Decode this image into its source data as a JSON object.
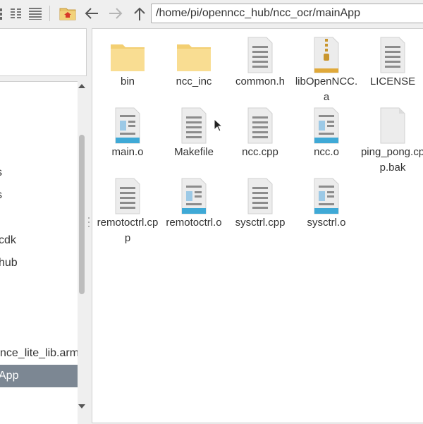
{
  "toolbar": {
    "path": "/home/pi/openncc_hub/ncc_ocr/mainApp",
    "icons": [
      "icon-view-icon",
      "compact-view-icon",
      "list-view-icon",
      "home-icon",
      "back-icon",
      "forward-icon",
      "up-icon"
    ]
  },
  "sidebar": {
    "tree": [
      {
        "label": "s",
        "selected": false
      },
      {
        "label": "s",
        "selected": false
      },
      {
        "label": "cdk",
        "selected": false
      },
      {
        "label": "hub",
        "selected": false
      },
      {
        "label": "nce_lite_lib.arml",
        "selected": false
      },
      {
        "label": "App",
        "selected": true
      }
    ]
  },
  "files": [
    {
      "name": "bin",
      "type": "folder"
    },
    {
      "name": "ncc_inc",
      "type": "folder"
    },
    {
      "name": "common.h",
      "type": "text"
    },
    {
      "name": "libOpenNCC.a",
      "type": "archive"
    },
    {
      "name": "LICENSE",
      "type": "text"
    },
    {
      "name": "main.o",
      "type": "object"
    },
    {
      "name": "Makefile",
      "type": "text"
    },
    {
      "name": "ncc.cpp",
      "type": "text"
    },
    {
      "name": "ncc.o",
      "type": "object"
    },
    {
      "name": "ping_pong.cpp.bak",
      "type": "blank"
    },
    {
      "name": "remotoctrl.cpp",
      "type": "text"
    },
    {
      "name": "remotoctrl.o",
      "type": "object"
    },
    {
      "name": "sysctrl.cpp",
      "type": "text"
    },
    {
      "name": "sysctrl.o",
      "type": "object"
    }
  ],
  "colors": {
    "folder": "#f7d98a",
    "selection": "#7c8793",
    "object_band": "#3fa9d6",
    "archive_band": "#e0a93a"
  }
}
